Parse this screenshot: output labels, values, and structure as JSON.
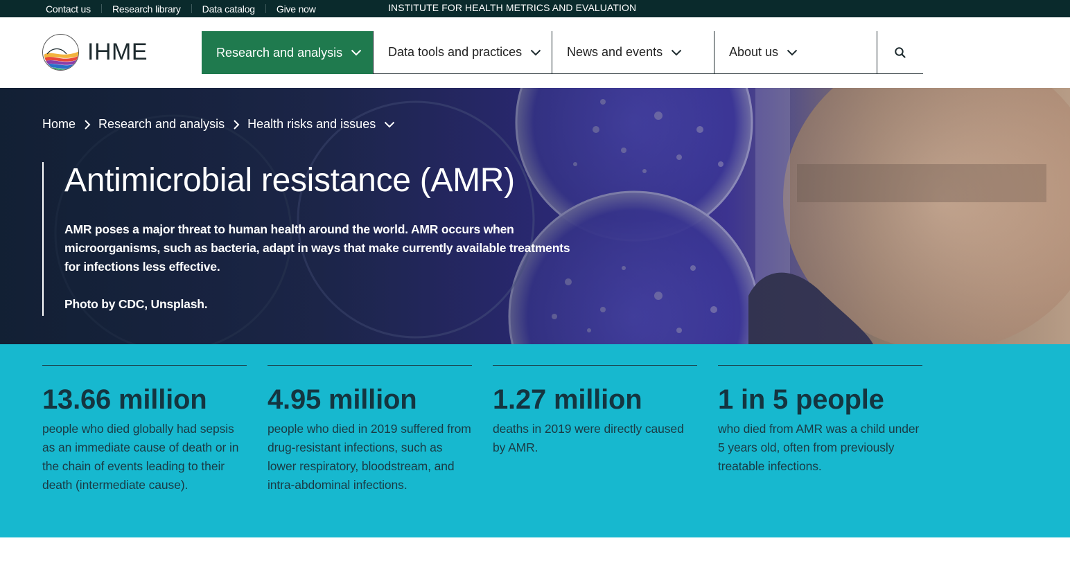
{
  "topbar": {
    "links": [
      "Contact us",
      "Research library",
      "Data catalog",
      "Give now"
    ],
    "institute": "INSTITUTE FOR HEALTH METRICS AND EVALUATION",
    "bg_color": "#0a2a2c"
  },
  "header": {
    "logo_text": "IHME",
    "nav": [
      {
        "label": "Research and analysis",
        "active": true
      },
      {
        "label": "Data tools and practices",
        "active": false
      },
      {
        "label": "News and events",
        "active": false
      },
      {
        "label": "About us",
        "active": false
      }
    ],
    "search_icon": "search-icon",
    "accent_color": "#1f7a4e"
  },
  "hero": {
    "breadcrumb": [
      "Home",
      "Research and analysis",
      "Health risks and issues"
    ],
    "title": "Antimicrobial resistance (AMR)",
    "description": "AMR poses a major threat to human health around the world. AMR occurs when microorganisms, such as bacteria, adapt in ways that make currently available treatments for infections less effective.",
    "credit": "Photo by CDC, Unsplash."
  },
  "stats": {
    "bg_color": "#17b8cf",
    "items": [
      {
        "value": "13.66 million",
        "desc": "people who died globally had sepsis as an immediate cause of death or in the chain of events leading to their death (intermediate cause)."
      },
      {
        "value": "4.95 million",
        "desc": "people who died in 2019 suffered from drug-resistant infections, such as lower respiratory, bloodstream, and intra-abdominal infections."
      },
      {
        "value": "1.27 million",
        "desc": "deaths in 2019 were directly caused by AMR."
      },
      {
        "value": "1 in 5 people",
        "desc": "who died from AMR was a child under 5 years old, often from previously treatable infections."
      }
    ]
  }
}
